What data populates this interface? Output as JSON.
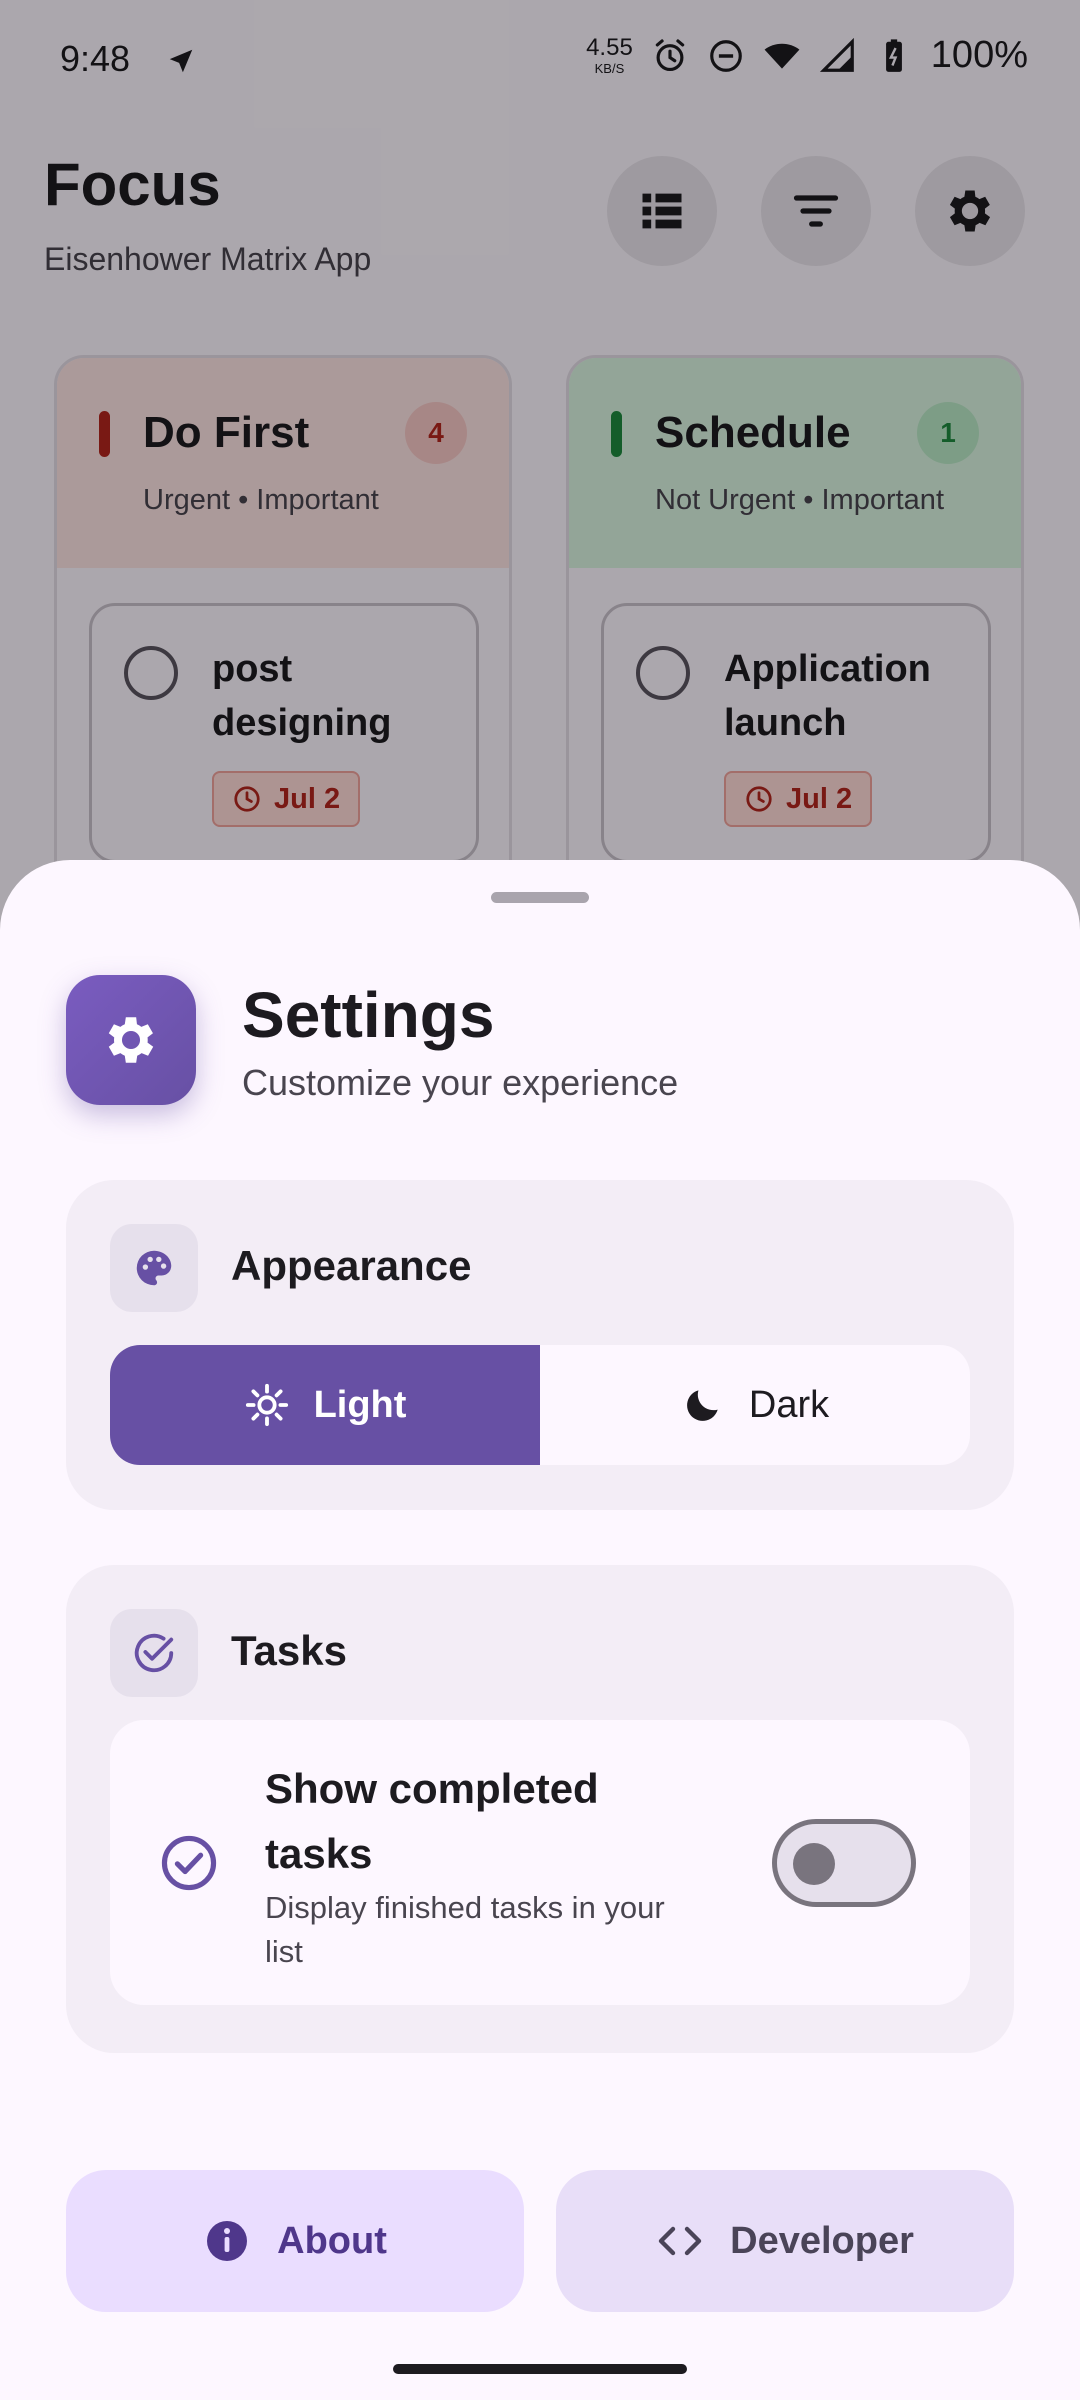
{
  "status_bar": {
    "time": "9:48",
    "net_speed": "4.55",
    "net_unit": "KB/S",
    "battery": "100%"
  },
  "app": {
    "title": "Focus",
    "subtitle": "Eisenhower Matrix App",
    "header_icons": [
      "list-icon",
      "filter-icon",
      "settings-icon"
    ]
  },
  "quadrants": [
    {
      "title": "Do First",
      "subtitle": "Urgent • Important",
      "count": "4",
      "accent": "#b3261e",
      "task": {
        "title": "post designing",
        "date": "Jul 2"
      }
    },
    {
      "title": "Schedule",
      "subtitle": "Not Urgent • Important",
      "count": "1",
      "accent": "#1e8a3e",
      "task": {
        "title": "Application launch",
        "date": "Jul 2"
      }
    }
  ],
  "sheet": {
    "title": "Settings",
    "subtitle": "Customize your experience",
    "appearance": {
      "title": "Appearance",
      "light_label": "Light",
      "dark_label": "Dark",
      "selected": "Light"
    },
    "tasks": {
      "title": "Tasks",
      "show_completed_title": "Show completed tasks",
      "show_completed_desc": "Display finished tasks in your list",
      "show_completed_on": false
    },
    "about_label": "About",
    "developer_label": "Developer"
  },
  "colors": {
    "primary": "#6750a4",
    "surface": "#fdf7ff",
    "card": "#f3edf6"
  }
}
